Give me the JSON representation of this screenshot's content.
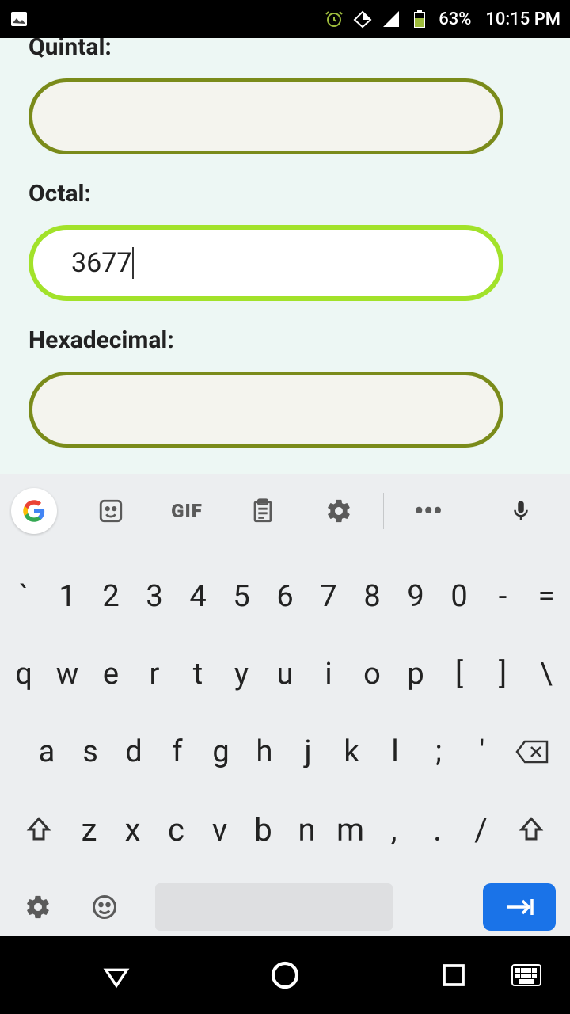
{
  "status": {
    "battery": "63%",
    "time": "10:15 PM"
  },
  "form": {
    "quintal": {
      "label": "Quintal:",
      "value": ""
    },
    "octal": {
      "label": "Octal:",
      "value": "3677"
    },
    "hex": {
      "label": "Hexadecimal:",
      "value": ""
    }
  },
  "keyboard": {
    "gif": "GIF",
    "row1": [
      "`",
      "1",
      "2",
      "3",
      "4",
      "5",
      "6",
      "7",
      "8",
      "9",
      "0",
      "-",
      "="
    ],
    "row2": [
      "q",
      "w",
      "e",
      "r",
      "t",
      "y",
      "u",
      "i",
      "o",
      "p",
      "[",
      "]",
      "\\"
    ],
    "row3": [
      "a",
      "s",
      "d",
      "f",
      "g",
      "h",
      "j",
      "k",
      "l",
      ";",
      "'"
    ],
    "row4": [
      "z",
      "x",
      "c",
      "v",
      "b",
      "n",
      "m",
      ",",
      ".",
      "/"
    ]
  }
}
